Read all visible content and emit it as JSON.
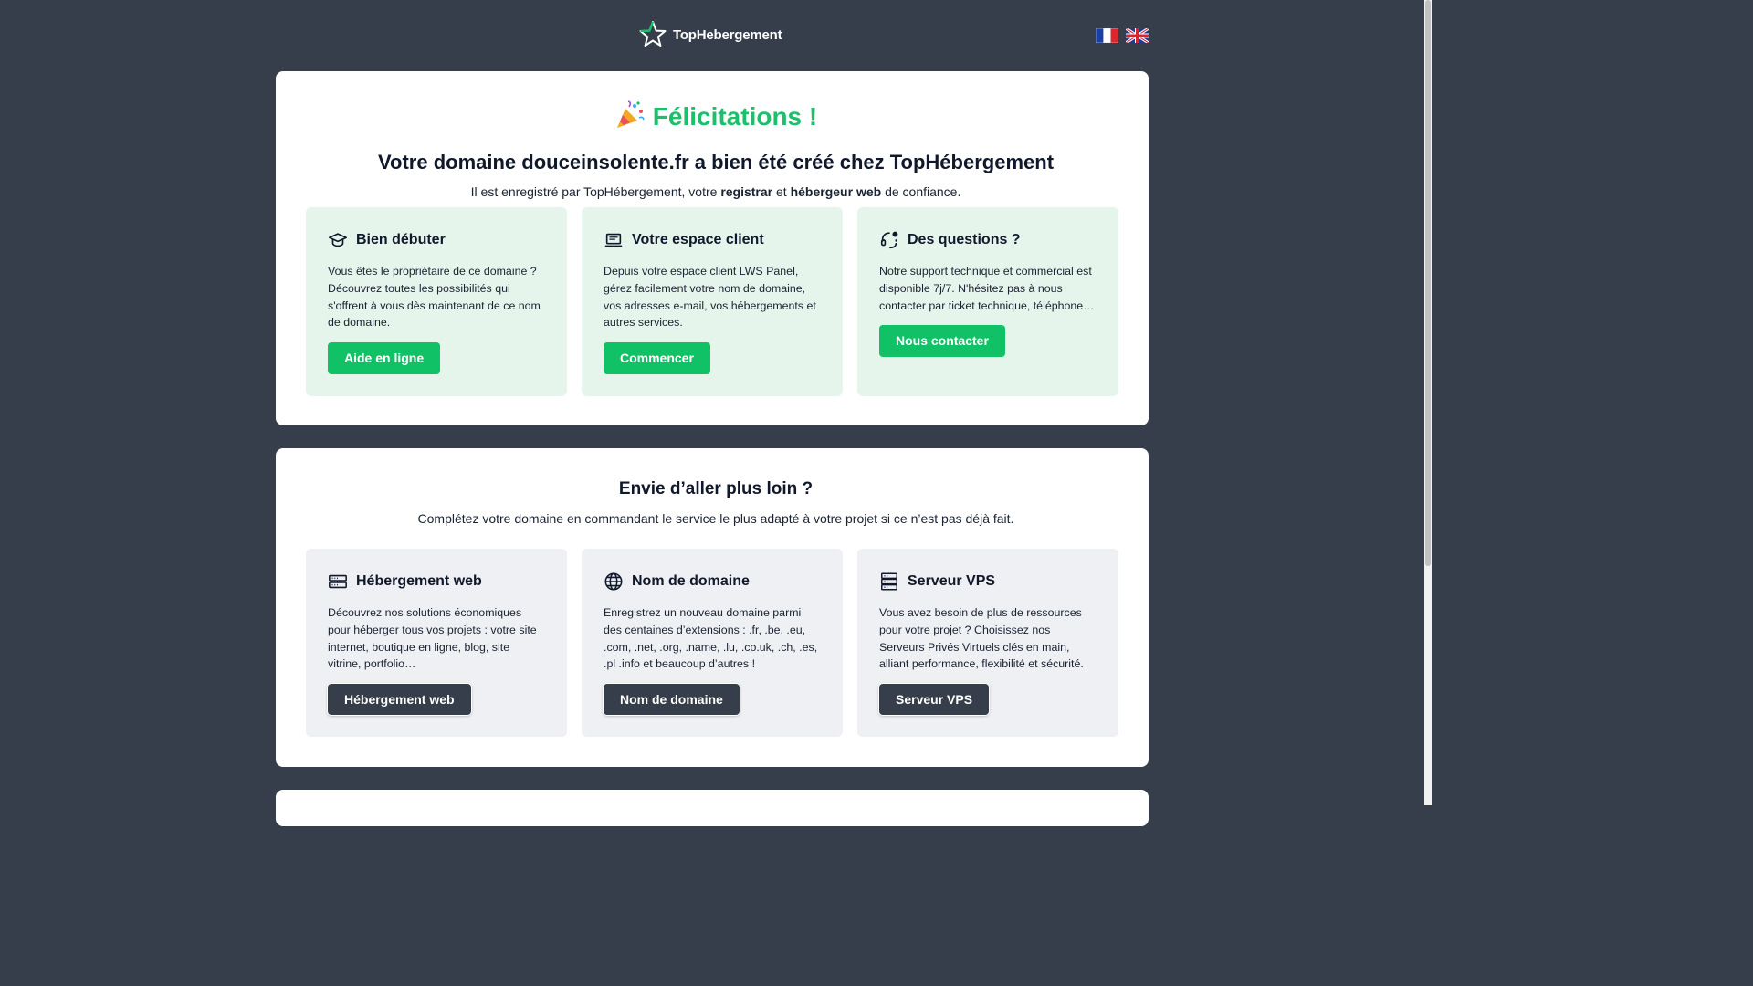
{
  "header": {
    "logo_text_bold": "Top",
    "logo_text_rest": "Hebergement",
    "languages": [
      "fr",
      "en"
    ]
  },
  "hero": {
    "title": "Félicitations !",
    "headline": "Votre domaine douceinsolente.fr a bien été créé chez TopHébergement",
    "sub_prefix": "Il est enregistré par TopHébergement, votre ",
    "sub_registrar": "registrar",
    "sub_and": " et ",
    "sub_host": "hébergeur web",
    "sub_suffix": " de confiance."
  },
  "start_cards": [
    {
      "icon": "graduation-cap-icon",
      "title": "Bien débuter",
      "text": "Vous êtes le propriétaire de ce domaine ? Découvrez toutes les possibilités qui s'offrent à vous dès maintenant de ce nom de domaine.",
      "button": "Aide en ligne"
    },
    {
      "icon": "laptop-icon",
      "title": "Votre espace client",
      "text": "Depuis votre espace client LWS Panel, gérez facilement votre nom de domaine, vos adresses e-mail, vos hébergements et autres services.",
      "button": "Commencer"
    },
    {
      "icon": "support-headset-icon",
      "title": "Des questions ?",
      "text": "Notre support technique et commercial est disponible 7j/7. N'hésitez pas à nous contacter par ticket technique, téléphone…",
      "button": "Nous contacter"
    }
  ],
  "more": {
    "title": "Envie d’aller plus loin ?",
    "subtitle": "Complétez votre domaine en commandant le service le plus adapté à votre projet si ce n’est pas déjà fait."
  },
  "service_cards": [
    {
      "icon": "server-icon",
      "title": "Hébergement web",
      "text": "Découvrez nos solutions économiques pour héberger tous vos projets : votre site internet, boutique en ligne, blog, site vitrine, portfolio…",
      "button": "Hébergement web"
    },
    {
      "icon": "globe-icon",
      "title": "Nom de domaine",
      "text": "Enregistrez un nouveau domaine parmi des centaines d’extensions : .fr, .be, .eu, .com, .net, .org, .name, .lu, .co.uk, .ch, .es, .pl .info et beaucoup d’autres !",
      "button": "Nom de domaine"
    },
    {
      "icon": "server-stack-icon",
      "title": "Serveur VPS",
      "text": "Vous avez besoin de plus de ressources pour votre projet ? Choisissez nos Serveurs Privés Virtuels clés en main, alliant performance, flexibilité et sécurité.",
      "button": "Serveur VPS"
    }
  ],
  "colors": {
    "background": "#353e4a",
    "accent_green": "#10c165",
    "card_green": "#e6f5ec",
    "card_grey": "#eef0f3",
    "dark_button": "#353e4a"
  }
}
